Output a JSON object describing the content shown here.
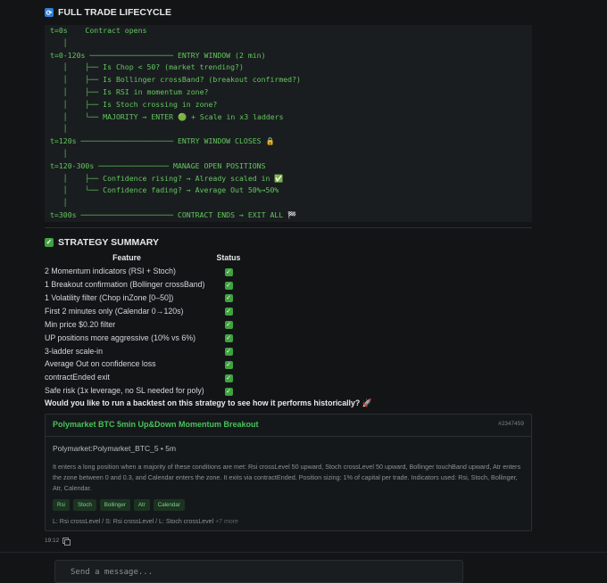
{
  "lifecycle": {
    "icon": "repeat-icon",
    "title": "FULL TRADE LIFECYCLE",
    "lines": [
      "t=0s    Contract opens",
      "   │",
      "t=0-120s ─────────────────── ENTRY WINDOW (2 min)",
      "   │    ├── Is Chop < 50? (market trending?)",
      "   │    ├── Is Bollinger crossBand? (breakout confirmed?)",
      "   │    ├── Is RSI in momentum zone?",
      "   │    ├── Is Stoch crossing in zone?",
      "   │    └── MAJORITY → ENTER 🟢 + Scale in x3 ladders",
      "   │",
      "t=120s ───────────────────── ENTRY WINDOW CLOSES 🔒",
      "   │",
      "t=120-300s ──────────────── MANAGE OPEN POSITIONS",
      "   │    ├── Confidence rising? → Already scaled in ✅",
      "   │    └── Confidence fading? → Average Out 50%→50%",
      "   │",
      "t=300s ───────────────────── CONTRACT ENDS → EXIT ALL 🏁"
    ]
  },
  "summary": {
    "icon": "check-icon",
    "title": "STRATEGY SUMMARY",
    "headers": [
      "Feature",
      "Status"
    ],
    "rows": [
      {
        "feature": "2 Momentum indicators (RSI + Stoch)",
        "status": "✓"
      },
      {
        "feature": "1 Breakout confirmation (Bollinger crossBand)",
        "status": "✓"
      },
      {
        "feature": "1 Volatility filter (Chop inZone [0–50])",
        "status": "✓"
      },
      {
        "feature": "First 2 minutes only (Calendar 0→120s)",
        "status": "✓"
      },
      {
        "feature": "Min price $0.20 filter",
        "status": "✓"
      },
      {
        "feature": "UP positions more aggressive (10% vs 6%)",
        "status": "✓"
      },
      {
        "feature": "3-ladder scale-in",
        "status": "✓"
      },
      {
        "feature": "Average Out on confidence loss",
        "status": "✓"
      },
      {
        "feature": "contractEnded exit",
        "status": "✓"
      },
      {
        "feature": "Safe risk (1x leverage, no SL needed for poly)",
        "status": "✓"
      }
    ]
  },
  "question": "Would you like to run a backtest on this strategy to see how it performs historically? 🚀",
  "card": {
    "title": "Polymarket BTC 5min Up&Down Momentum Breakout",
    "id": "#2347459",
    "subtitle": "Polymarket:Polymarket_BTC_5 • 5m",
    "description": "It enters a long position when a majority of these conditions are met: Rsi crossLevel 50 upward, Stoch crossLevel 50 upward, Bollinger touchBand upward, Atr enters the zone between 0 and 0.3, and Calendar enters the zone. It exits via contractEnded. Position sizing: 1% of capital per trade. Indicators used: Rsi, Stoch, Bollinger, Atr, Calendar.",
    "tags": [
      "Rsi",
      "Stoch",
      "Bollinger",
      "Atr",
      "Calendar"
    ],
    "footer": "L: Rsi crossLevel / S: Rsi crossLevel / L: Stoch crossLevel",
    "more": "+7 more"
  },
  "meta": {
    "time": "19:12",
    "copy_icon": "copy-icon"
  },
  "composer": {
    "placeholder": "Send a message..."
  }
}
